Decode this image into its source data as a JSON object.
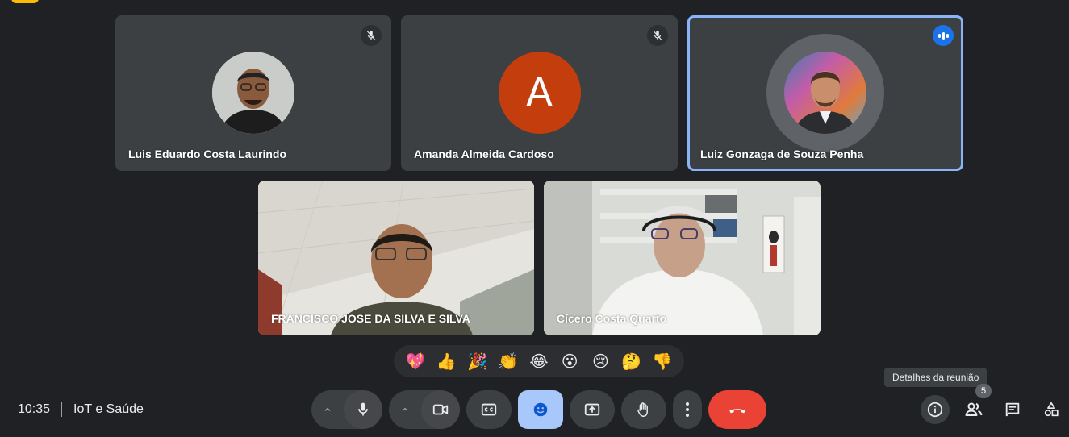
{
  "participants": [
    {
      "name": "Luis Eduardo Costa Laurindo",
      "muted": true
    },
    {
      "name": "Amanda Almeida Cardoso",
      "avatar_letter": "A",
      "muted": true
    },
    {
      "name": "Luiz Gonzaga de Souza Penha",
      "speaking": true
    },
    {
      "name": "FRANCISCO JOSE DA SILVA E SILVA"
    },
    {
      "name": "Cícero Costa Quarto"
    }
  ],
  "reactions": [
    "💖",
    "👍",
    "🎉",
    "👏",
    "😂",
    "😮",
    "😢",
    "🤔",
    "👎"
  ],
  "meeting": {
    "time": "10:35",
    "title": "IoT e Saúde"
  },
  "tooltip": "Detalhes da reunião",
  "participant_count": "5",
  "colors": {
    "accent": "#8ab4f8",
    "end_call": "#ea4335",
    "reaction_active": "#a8c7fa",
    "speaking": "#1a73e8"
  }
}
